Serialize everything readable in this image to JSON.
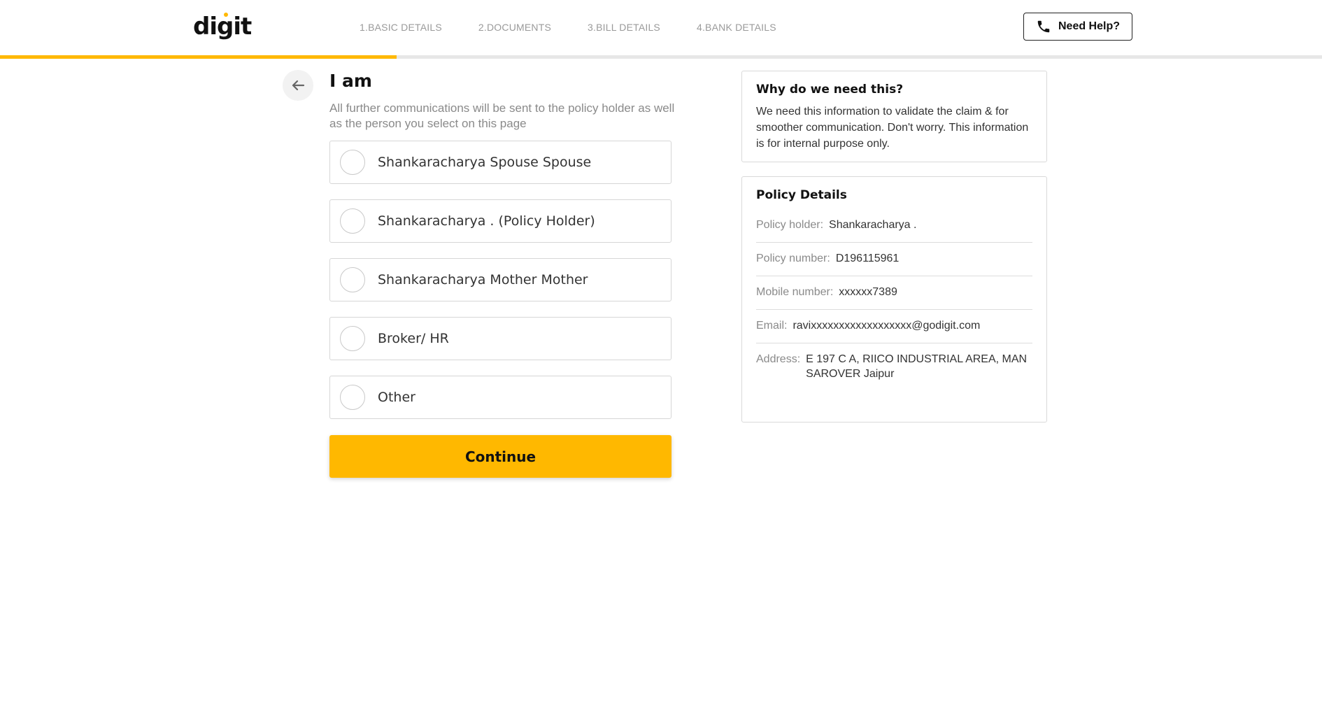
{
  "header": {
    "logo": "digit",
    "steps": [
      {
        "label": "1.BASIC DETAILS"
      },
      {
        "label": "2.DOCUMENTS"
      },
      {
        "label": "3.BILL DETAILS"
      },
      {
        "label": "4.BANK DETAILS"
      }
    ],
    "help_label": "Need Help?",
    "progress_percent": 30
  },
  "main": {
    "title": "I am",
    "subtitle": "All further communications will be sent to the policy holder as well as the person you select on this page",
    "options": [
      {
        "label": "Shankaracharya Spouse Spouse"
      },
      {
        "label": "Shankaracharya . (Policy Holder)"
      },
      {
        "label": "Shankaracharya Mother Mother"
      },
      {
        "label": "Broker/ HR"
      },
      {
        "label": "Other"
      }
    ],
    "continue_label": "Continue"
  },
  "why": {
    "title": "Why do we need this?",
    "text": "We need this information to validate the claim & for smoother communication. Don't worry. This information is for internal purpose only."
  },
  "policy": {
    "title": "Policy Details",
    "rows": [
      {
        "key": "Policy holder:",
        "value": "Shankaracharya ."
      },
      {
        "key": "Policy number:",
        "value": "D196115961"
      },
      {
        "key": "Mobile number:",
        "value": "xxxxxx7389"
      },
      {
        "key": "Email:",
        "value": "ravixxxxxxxxxxxxxxxxxx@godigit.com"
      },
      {
        "key": "Address:",
        "value": "E 197 C A, RIICO INDUSTRIAL AREA, MANSAROVER Jaipur"
      }
    ]
  },
  "colors": {
    "accent": "#ffb800",
    "progress_track": "#e7e7e7"
  },
  "icons": {
    "help": "phone-icon",
    "back": "arrow-left-icon"
  }
}
